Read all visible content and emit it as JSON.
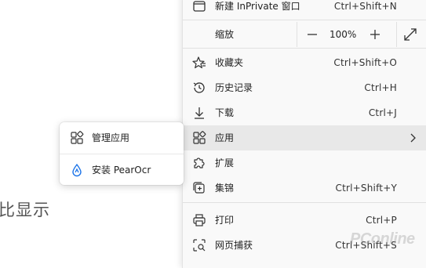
{
  "page": {
    "background_text": "比显示"
  },
  "menu": {
    "new_inprivate": {
      "label": "新建 InPrivate 窗口",
      "shortcut": "Ctrl+Shift+N"
    },
    "zoom": {
      "label": "缩放",
      "value": "100%"
    },
    "favorites": {
      "label": "收藏夹",
      "shortcut": "Ctrl+Shift+O"
    },
    "history": {
      "label": "历史记录",
      "shortcut": "Ctrl+H"
    },
    "downloads": {
      "label": "下载",
      "shortcut": "Ctrl+J"
    },
    "apps": {
      "label": "应用"
    },
    "extensions": {
      "label": "扩展"
    },
    "collections": {
      "label": "集锦",
      "shortcut": "Ctrl+Shift+Y"
    },
    "print": {
      "label": "打印",
      "shortcut": "Ctrl+P"
    },
    "web_capture": {
      "label": "网页捕获",
      "shortcut": "Ctrl+Shift+S"
    }
  },
  "submenu": {
    "manage_apps": {
      "label": "管理应用"
    },
    "install_app": {
      "label": "安装 PearOcr"
    }
  },
  "watermark": "PConline",
  "colors": {
    "highlight": "#e8e8e8",
    "menu_bg": "#f9f9f9",
    "install_icon": "#1a73e8"
  }
}
